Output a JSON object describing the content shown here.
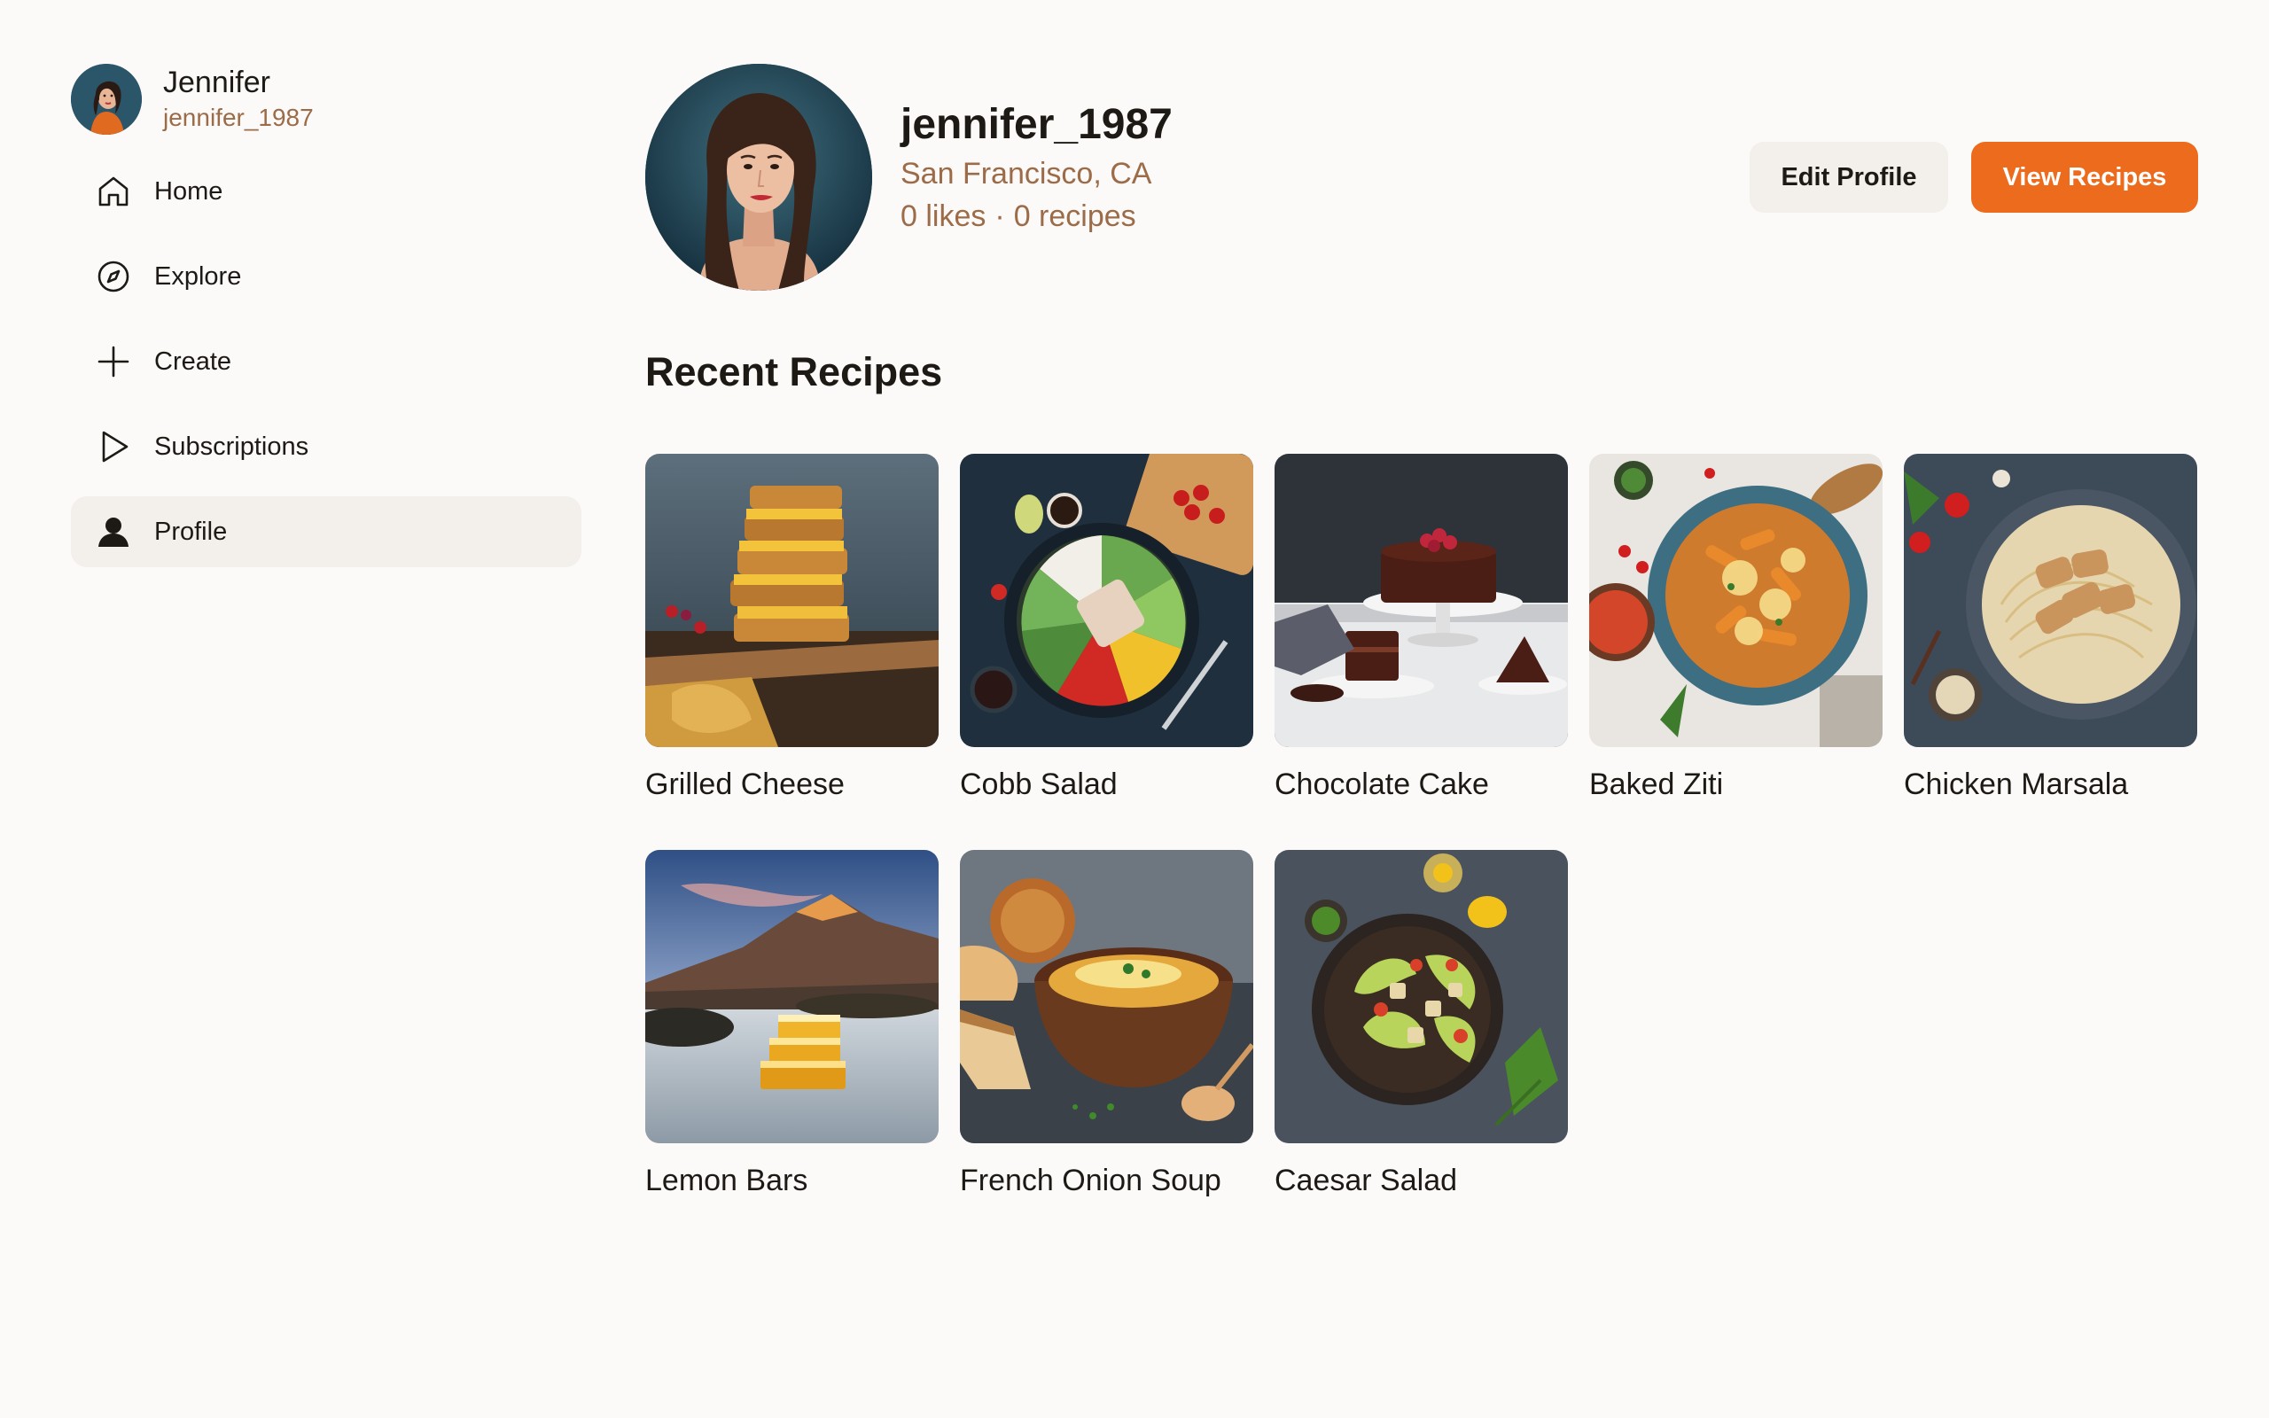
{
  "user": {
    "display_name": "Jennifer",
    "handle": "jennifer_1987"
  },
  "nav": [
    {
      "label": "Home",
      "icon": "home-icon",
      "active": false
    },
    {
      "label": "Explore",
      "icon": "compass-icon",
      "active": false
    },
    {
      "label": "Create",
      "icon": "plus-icon",
      "active": false
    },
    {
      "label": "Subscriptions",
      "icon": "play-icon",
      "active": false
    },
    {
      "label": "Profile",
      "icon": "person-icon",
      "active": true
    }
  ],
  "profile": {
    "username": "jennifer_1987",
    "location": "San Francisco, CA",
    "likes": "0 likes",
    "separator": "·",
    "recipes": "0 recipes"
  },
  "actions": {
    "edit_label": "Edit Profile",
    "view_label": "View Recipes"
  },
  "section": {
    "title": "Recent Recipes"
  },
  "recipes": [
    {
      "title": "Grilled Cheese",
      "image": "grilled-cheese-photo"
    },
    {
      "title": "Cobb Salad",
      "image": "cobb-salad-photo"
    },
    {
      "title": "Chocolate Cake",
      "image": "chocolate-cake-photo"
    },
    {
      "title": "Baked Ziti",
      "image": "baked-ziti-photo"
    },
    {
      "title": "Chicken Marsala",
      "image": "chicken-marsala-photo"
    },
    {
      "title": "Lemon Bars",
      "image": "lemon-bars-photo"
    },
    {
      "title": "French Onion Soup",
      "image": "french-onion-soup-photo"
    },
    {
      "title": "Caesar Salad",
      "image": "caesar-salad-photo"
    }
  ],
  "colors": {
    "accent": "#ec6b1c",
    "muted_text": "#9c6b47",
    "active_bg": "#f3f0ec",
    "page_bg": "#fbfaf9"
  }
}
